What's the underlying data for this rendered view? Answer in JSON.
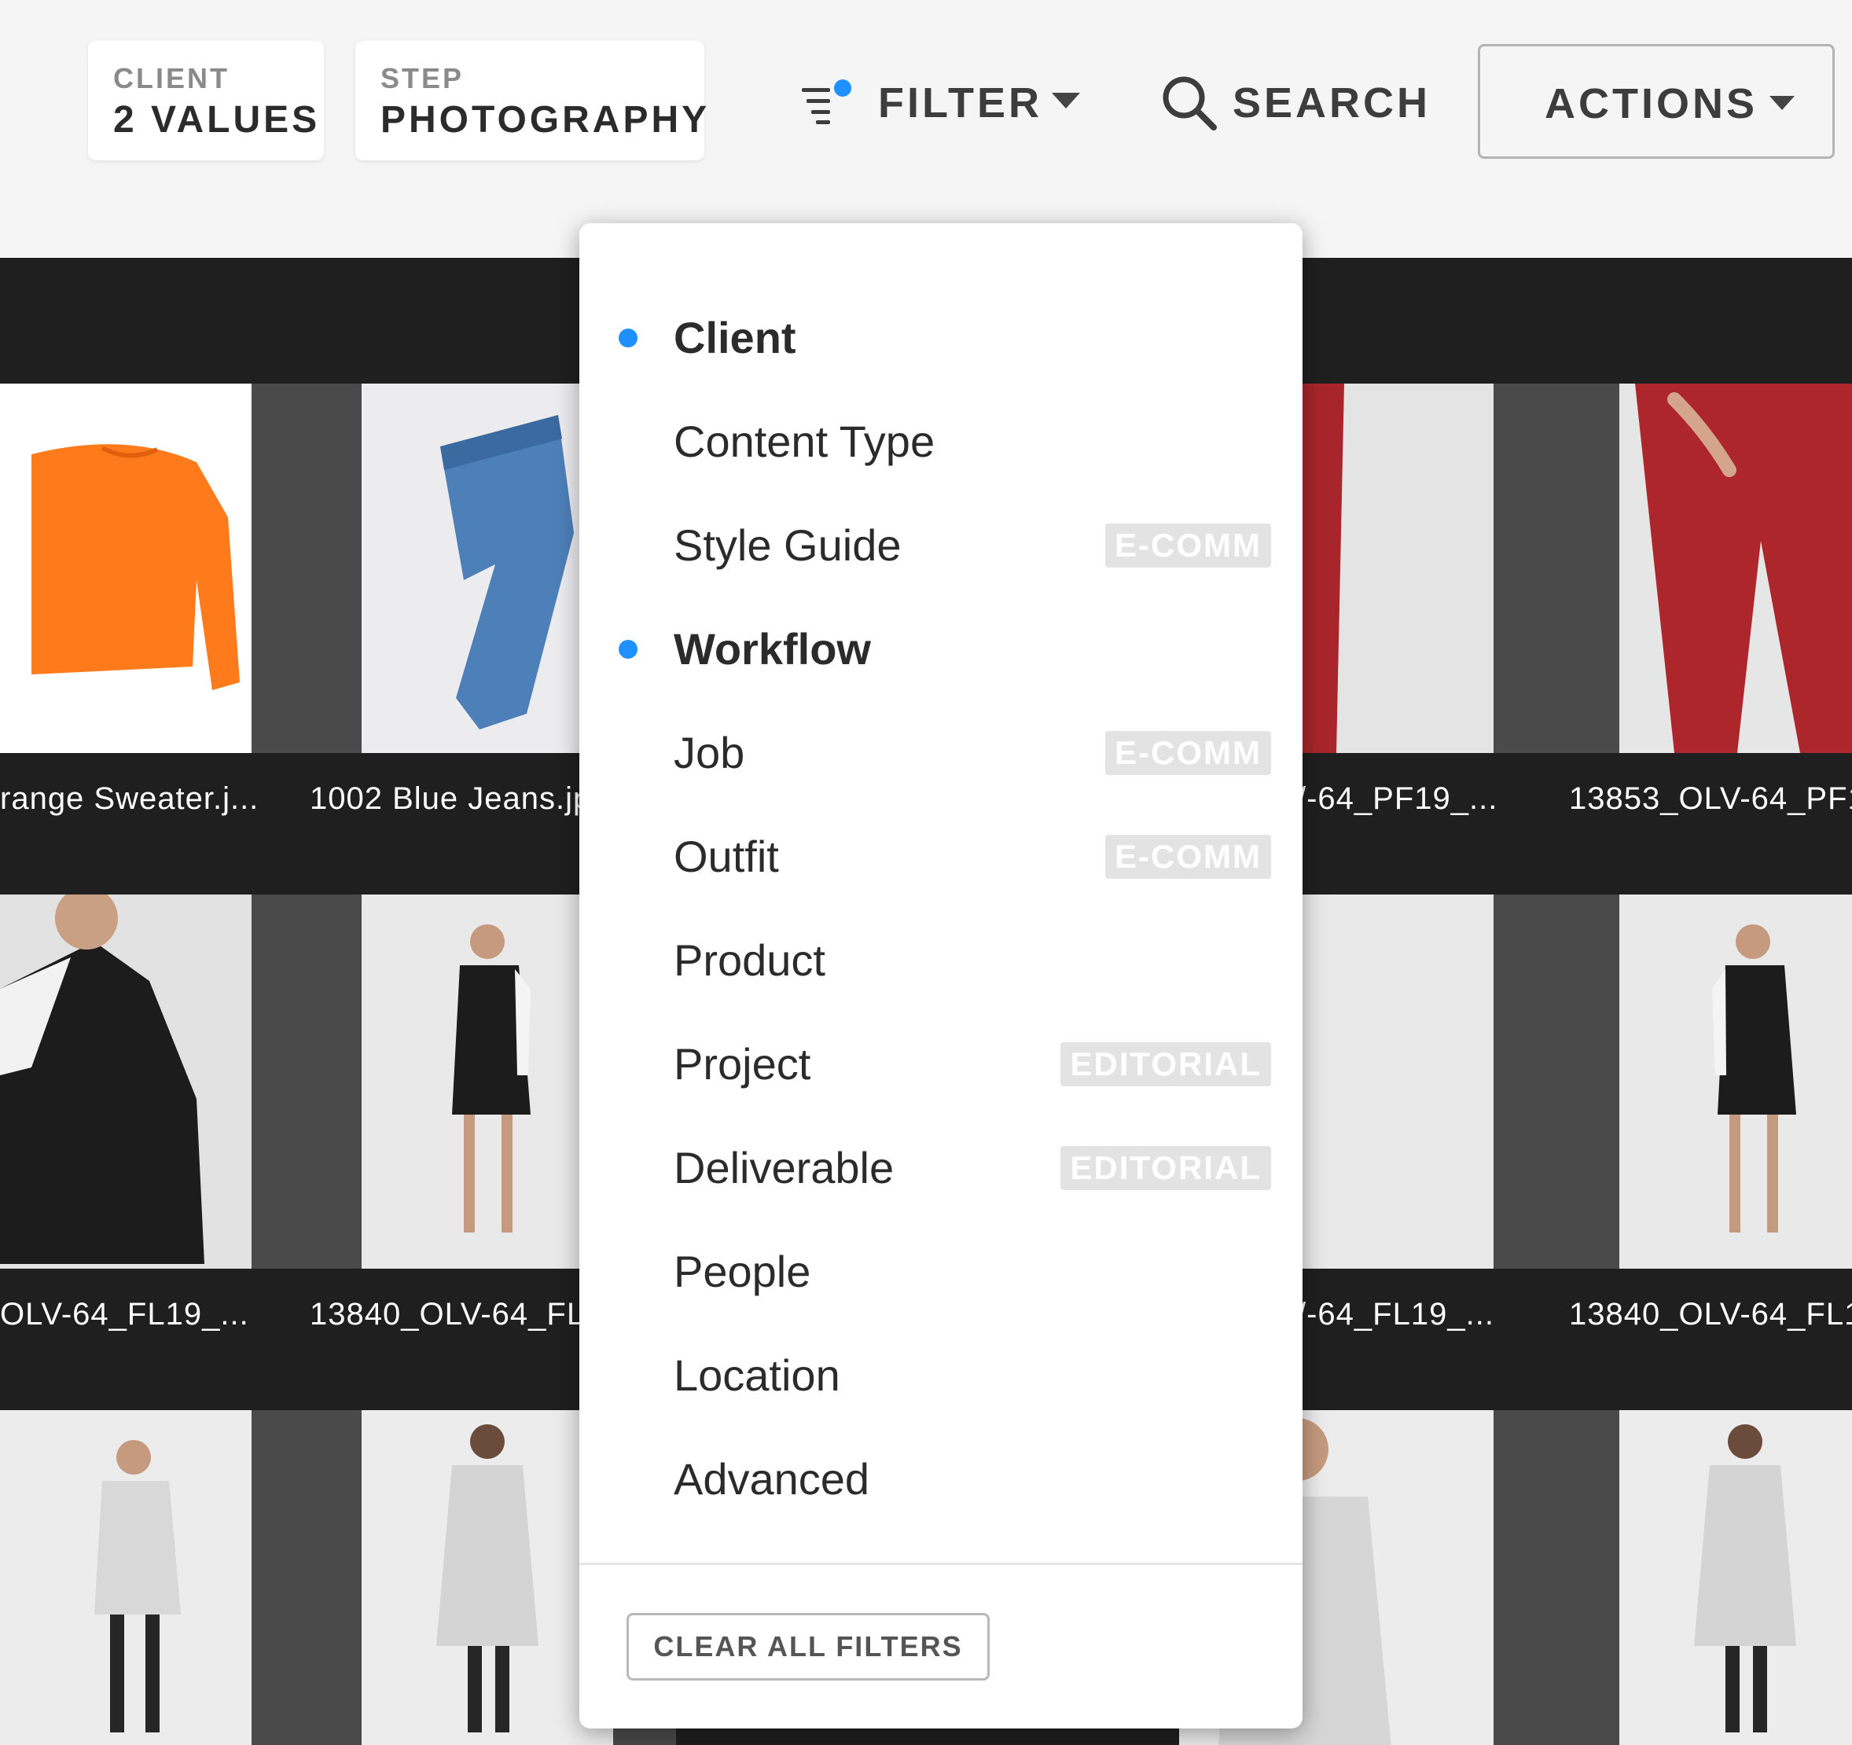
{
  "toolbar": {
    "client_chip": {
      "label": "CLIENT",
      "value": "2 VALUES"
    },
    "step_chip": {
      "label": "STEP",
      "value": "PHOTOGRAPHY"
    },
    "filter_label": "FILTER",
    "search_label": "SEARCH",
    "actions_label": "ACTIONS"
  },
  "grid": {
    "captions": [
      "range Sweater.j...",
      "1002 Blue Jeans.jp",
      "/-64_PF19_...",
      "13853_OLV-64_PF1",
      "OLV-64_FL19_...",
      "13840_OLV-64_FL1",
      "/-64_FL19_...",
      "13840_OLV-64_FL1"
    ]
  },
  "filter_menu": {
    "items": [
      {
        "label": "Client",
        "active": true,
        "badge": ""
      },
      {
        "label": "Content Type",
        "active": false,
        "badge": ""
      },
      {
        "label": "Style Guide",
        "active": false,
        "badge": "E-COMM"
      },
      {
        "label": "Workflow",
        "active": true,
        "badge": ""
      },
      {
        "label": "Job",
        "active": false,
        "badge": "E-COMM"
      },
      {
        "label": "Outfit",
        "active": false,
        "badge": "E-COMM"
      },
      {
        "label": "Product",
        "active": false,
        "badge": ""
      },
      {
        "label": "Project",
        "active": false,
        "badge": "EDITORIAL"
      },
      {
        "label": "Deliverable",
        "active": false,
        "badge": "EDITORIAL"
      },
      {
        "label": "People",
        "active": false,
        "badge": ""
      },
      {
        "label": "Location",
        "active": false,
        "badge": ""
      },
      {
        "label": "Advanced",
        "active": false,
        "badge": ""
      }
    ],
    "clear_label": "CLEAR ALL FILTERS"
  },
  "colors": {
    "active_dot": "#1e90ff",
    "grid_background": "#1f1f1f",
    "toolbar_background": "#f5f5f5"
  }
}
